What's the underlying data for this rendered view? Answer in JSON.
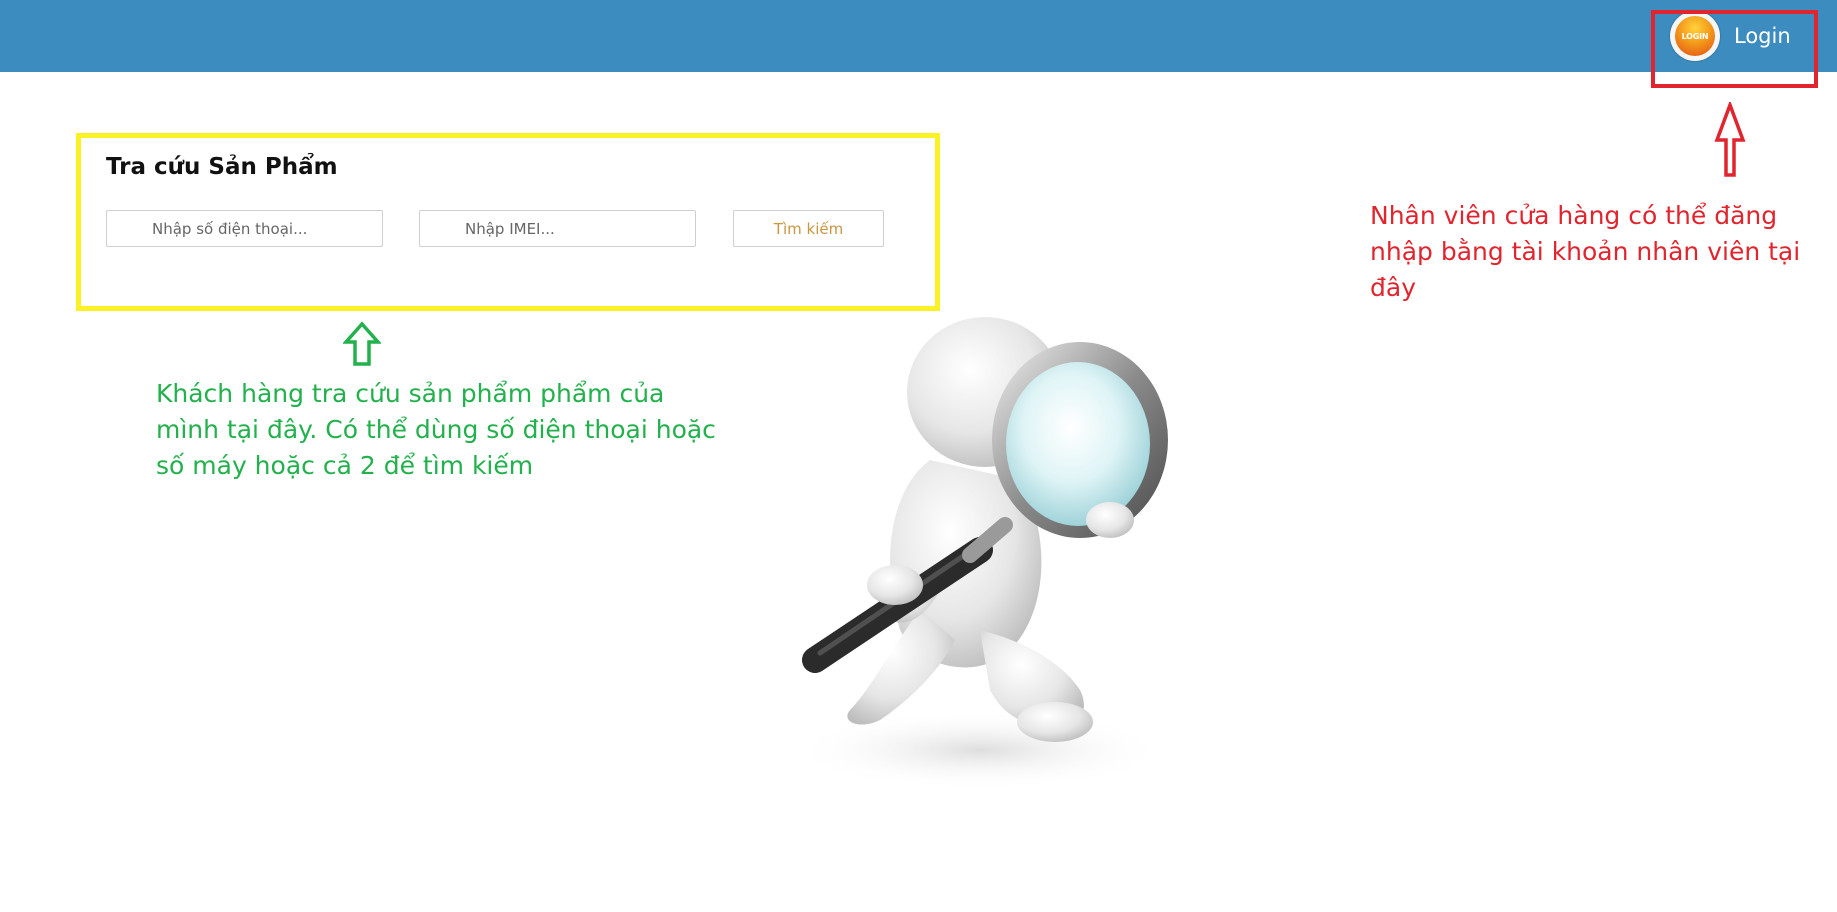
{
  "header": {
    "login_badge_text": "LOGIN",
    "login_label": "Login",
    "bar_color": "#3d8cbf"
  },
  "search_panel": {
    "title": "Tra cứu Sản Phẩm",
    "phone_placeholder": "Nhập số điện thoại...",
    "imei_placeholder": "Nhập IMEI...",
    "search_button_label": "Tìm kiếm"
  },
  "annotations": {
    "customer_note": "Khách hàng tra cứu sản phẩm phẩm của mình tại đây. Có thể dùng số điện thoại hoặc số máy hoặc cả 2 để tìm kiếm",
    "staff_note": "Nhân viên cửa hàng có thể đăng nhập bằng tài khoản nhân viên tại đây",
    "customer_note_color": "#22b14c",
    "staff_note_color": "#e0252f",
    "search_highlight_color": "#fbf125",
    "login_highlight_color": "#e0252f"
  },
  "illustration": {
    "icon": "person-with-magnifying-glass-icon"
  }
}
